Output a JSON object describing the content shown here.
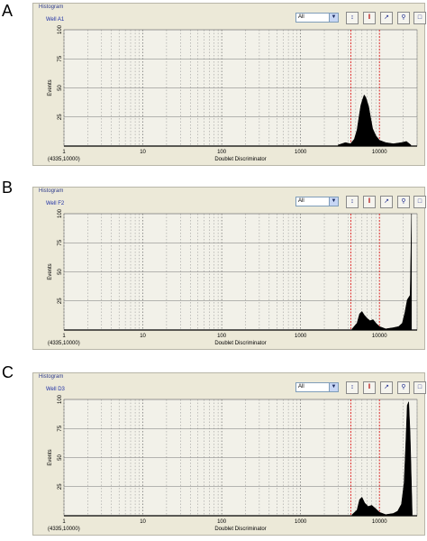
{
  "figure": {
    "panel_letters": [
      "A",
      "B",
      "C"
    ]
  },
  "toolbar": {
    "panel_title": "Histogram",
    "dropdown_value": "All",
    "icons": [
      "y-scale-icon",
      "bar-chart-icon",
      "line-chart-icon",
      "zoom-icon",
      "window-icon"
    ]
  },
  "colors": {
    "panel_bg": "#ece9d8",
    "plot_bg": "#f2f1e9",
    "gate_line": "#e02020",
    "histogram_fill": "#000000"
  },
  "chart_data": [
    {
      "type": "area",
      "well": "Well A1",
      "scale": "log",
      "xlabel": "Doublet Discriminator",
      "ylabel": "Events",
      "corner_label": "(4335,10000)",
      "xlim": [
        1,
        30000
      ],
      "ylim": [
        0,
        100
      ],
      "x_ticks": [
        1,
        10,
        100,
        1000,
        10000
      ],
      "y_ticks": [
        25,
        50,
        75,
        100
      ],
      "gates": [
        4335,
        10000
      ],
      "x": [
        3000,
        3700,
        4300,
        4800,
        5200,
        5500,
        5800,
        6100,
        6400,
        6700,
        7000,
        7300,
        7700,
        8200,
        9000,
        10000,
        12000,
        15000,
        19000,
        22000,
        25000
      ],
      "y": [
        1,
        3,
        2,
        6,
        14,
        25,
        35,
        40,
        44,
        42,
        38,
        34,
        25,
        15,
        9,
        5,
        3,
        2,
        3,
        4,
        1
      ]
    },
    {
      "type": "area",
      "well": "Well F2",
      "scale": "log",
      "xlabel": "Doublet Discriminator",
      "ylabel": "Events",
      "corner_label": "(4335,10000)",
      "xlim": [
        1,
        30000
      ],
      "ylim": [
        0,
        100
      ],
      "x_ticks": [
        1,
        10,
        100,
        1000,
        10000
      ],
      "y_ticks": [
        25,
        50,
        75,
        100
      ],
      "gates": [
        4335,
        10000
      ],
      "x": [
        4500,
        5200,
        5600,
        6000,
        6400,
        7000,
        7600,
        8300,
        9000,
        10000,
        12000,
        15000,
        17500,
        19500,
        21000,
        22500,
        24500,
        25500
      ],
      "y": [
        1,
        6,
        14,
        16,
        13,
        10,
        8,
        9,
        6,
        3,
        1,
        2,
        3,
        6,
        15,
        26,
        30,
        100
      ]
    },
    {
      "type": "area",
      "well": "Well D3",
      "scale": "log",
      "xlabel": "Doublet Discriminator",
      "ylabel": "Events",
      "corner_label": "(4335,10000)",
      "xlim": [
        1,
        30000
      ],
      "ylim": [
        0,
        100
      ],
      "x_ticks": [
        1,
        10,
        100,
        1000,
        10000
      ],
      "y_ticks": [
        25,
        50,
        75,
        100
      ],
      "gates": [
        4335,
        10000
      ],
      "x": [
        4500,
        5200,
        5600,
        6000,
        6500,
        7200,
        8000,
        9000,
        10000,
        12000,
        15000,
        17000,
        19000,
        20500,
        21500,
        22500,
        23500,
        24500,
        26000
      ],
      "y": [
        1,
        5,
        14,
        16,
        11,
        8,
        9,
        6,
        3,
        1,
        2,
        4,
        10,
        28,
        60,
        95,
        98,
        70,
        3
      ]
    }
  ]
}
